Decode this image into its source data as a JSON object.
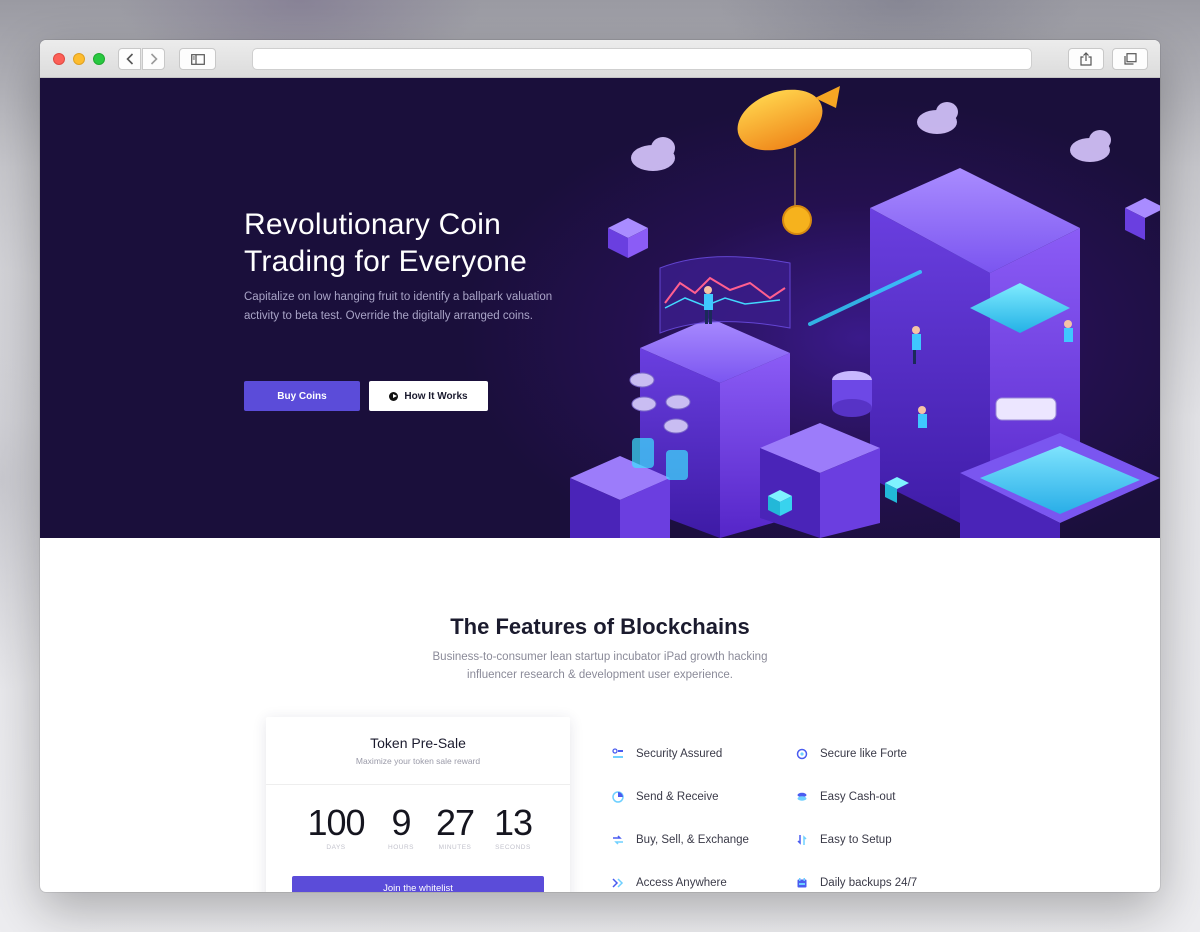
{
  "hero": {
    "title": "Revolutionary Coin\nTrading for Everyone",
    "subtitle": "Capitalize on low hanging fruit to identify a ballpark valuation\nactivity to beta test. Override the digitally arranged coins.",
    "buy_label": "Buy Coins",
    "how_label": "How It Works"
  },
  "features": {
    "title": "The Features of Blockchains",
    "subtitle": "Business-to-consumer lean startup incubator iPad growth hacking\ninfluencer research & development user experience.",
    "items": [
      {
        "label": "Security Assured",
        "icon": "security-icon"
      },
      {
        "label": "Secure like Forte",
        "icon": "shield-icon"
      },
      {
        "label": "Send & Receive",
        "icon": "send-receive-icon"
      },
      {
        "label": "Easy Cash-out",
        "icon": "coins-icon"
      },
      {
        "label": "Buy, Sell, & Exchange",
        "icon": "exchange-icon"
      },
      {
        "label": "Easy to Setup",
        "icon": "setup-icon"
      },
      {
        "label": "Access Anywhere",
        "icon": "access-icon"
      },
      {
        "label": "Daily backups 24/7",
        "icon": "backup-icon"
      }
    ]
  },
  "presale": {
    "title": "Token Pre-Sale",
    "subtitle": "Maximize your token sale reward",
    "countdown": [
      {
        "value": "100",
        "label": "DAYS"
      },
      {
        "value": "9",
        "label": "HOURS"
      },
      {
        "value": "27",
        "label": "MINUTES"
      },
      {
        "value": "13",
        "label": "SECONDS"
      }
    ],
    "button_label": "Join the whitelist"
  },
  "colors": {
    "accent": "#5b4cd9",
    "hero_bg": "#1b1038",
    "feature_icon": "#4a5cf0"
  }
}
